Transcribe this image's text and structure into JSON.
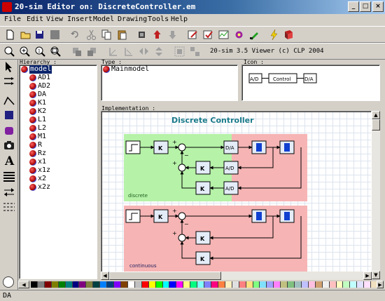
{
  "window": {
    "title": "20-sim Editor on: DiscreteController.em"
  },
  "menu": [
    "File",
    "Edit",
    "View",
    "Insert",
    "Model",
    "Drawing",
    "Tools",
    "Help"
  ],
  "viewer_text": "20-sim 3.5 Viewer (c) CLP 2004",
  "panels": {
    "hierarchy_label": "Hierarchy :",
    "type_label": "Type :",
    "icon_label": "Icon :",
    "implementation_label": "Implementation :"
  },
  "hierarchy": {
    "root": "model",
    "children": [
      "AD1",
      "AD2",
      "DA",
      "K1",
      "K2",
      "L1",
      "L2",
      "M1",
      "R",
      "Rz",
      "x1",
      "x1z",
      "x2",
      "x2z"
    ]
  },
  "type_value": "Mainmodel",
  "icon_diagram": {
    "input": "A/D",
    "middle": "Control",
    "output": "D/A"
  },
  "diagram": {
    "title": "Discrete Controller",
    "discrete_label": "discrete",
    "continuous_label": "continuous",
    "k_label": "K",
    "ad_label": "A/D",
    "da_label": "D/A",
    "plus": "+",
    "minus": "−",
    "colors": {
      "green": "#b6f2a8",
      "pink": "#f6b4b4",
      "title": "#1a7a8a",
      "block_fill": "#e4ecf8"
    }
  },
  "status": {
    "text": "DA"
  },
  "palette_colors": [
    "#000000",
    "#808080",
    "#800000",
    "#808000",
    "#008000",
    "#008080",
    "#000080",
    "#800080",
    "#808040",
    "#004040",
    "#0080ff",
    "#004080",
    "#8000ff",
    "#804000",
    "#ffffff",
    "#c0c0c0",
    "#ff0000",
    "#ffff00",
    "#00ff00",
    "#00ffff",
    "#0000ff",
    "#ff00ff",
    "#ffff80",
    "#00ff80",
    "#80ffff",
    "#8080ff",
    "#ff0080",
    "#ff8040",
    "#fff0c0",
    "#e0e0e0",
    "#ff8080",
    "#ffe080",
    "#80ff80",
    "#80e0ff",
    "#a0a0ff",
    "#ff80ff",
    "#c0c080",
    "#80c080",
    "#a0c0c0",
    "#c0c0ff",
    "#ffc0e0",
    "#d0a070",
    "#f0f0f0",
    "#ffc0c0",
    "#ffffc0",
    "#c0ffc0",
    "#c0ffff",
    "#e0e0ff",
    "#ffe0ff",
    "#f0e0c0"
  ]
}
